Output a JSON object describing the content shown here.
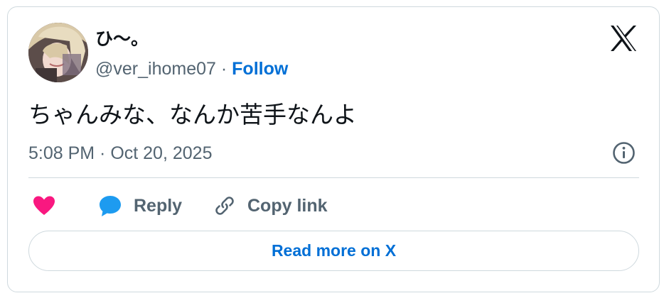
{
  "author": {
    "display_name": "ひ〜。",
    "handle": "@ver_ihome07",
    "separator": "·",
    "follow_label": "Follow"
  },
  "tweet": {
    "text": "ちゃんみな、なんか苦手なんよ",
    "timestamp": "5:08 PM · Oct 20, 2025"
  },
  "actions": {
    "reply_label": "Reply",
    "copy_link_label": "Copy link"
  },
  "read_more_label": "Read more on X",
  "colors": {
    "like": "#f91880",
    "reply": "#1d9bf0",
    "link": "#006fd6",
    "secondary_text": "#536471",
    "border": "#cfd9de"
  },
  "icons": [
    "avatar",
    "x-logo-icon",
    "info-icon",
    "heart-icon",
    "reply-bubble-icon",
    "link-icon"
  ]
}
